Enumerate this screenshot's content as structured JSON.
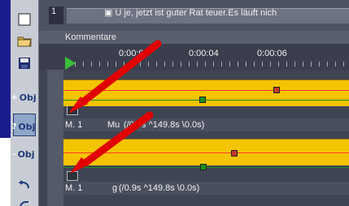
{
  "toolbar": {
    "obj_label": "Obj",
    "icons": [
      "checkbox-icon",
      "open-folder-icon",
      "save-icon",
      "obj-add-icon",
      "obj-help-icon",
      "obj-remove-icon",
      "undo-icon",
      "redo-icon"
    ]
  },
  "top": {
    "track_number": "1",
    "comment_text": "U je, jetzt ist guter Rat teuer.Es läuft nich"
  },
  "comment_section": {
    "label": "Kommentare"
  },
  "timeline": {
    "ticks": [
      "0:00:02",
      "0:00:04",
      "0:00:06"
    ]
  },
  "tracks": [
    {
      "info_prefix": "M. 1",
      "info_text": "Mu",
      "info_suffix": "(/0.9s ^149.8s \\0.0s)"
    },
    {
      "info_prefix": "M. 1",
      "info_text": "g",
      "info_suffix": "(/0.9s ^149.8s \\0.0s)"
    }
  ],
  "colors": {
    "lane": "#f5c400",
    "red_line": "#ff3b2b",
    "green_line": "#1f8a1f",
    "arrow": "#e00000"
  }
}
